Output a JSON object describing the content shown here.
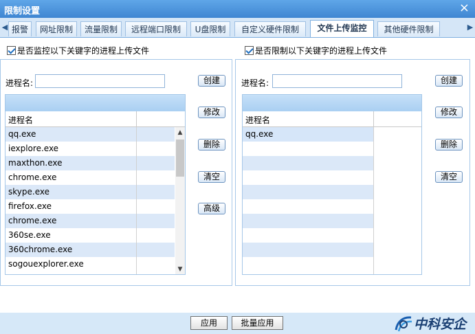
{
  "window": {
    "title": "限制设置",
    "close_symbol": "×"
  },
  "tabs": [
    {
      "label": "报警"
    },
    {
      "label": "网址限制"
    },
    {
      "label": "流量限制"
    },
    {
      "label": "远程端口限制"
    },
    {
      "label": "U盘限制"
    },
    {
      "label": "自定义硬件限制"
    },
    {
      "label": "文件上传监控"
    },
    {
      "label": "其他硬件限制"
    }
  ],
  "active_tab": "文件上传监控",
  "left": {
    "checkbox_label": "是否监控以下关键字的进程上传文件",
    "process_label": "进程名:",
    "process_value": "",
    "column_header": "进程名",
    "rows": [
      "qq.exe",
      "iexplore.exe",
      "maxthon.exe",
      "chrome.exe",
      "skype.exe",
      "firefox.exe",
      "chrome.exe",
      "360se.exe",
      "360chrome.exe",
      "sogouexplorer.exe"
    ],
    "buttons": {
      "create": "创建",
      "modify": "修改",
      "delete": "删除",
      "clear": "清空",
      "advanced": "高级"
    }
  },
  "right": {
    "checkbox_label": "是否限制以下关键字的进程上传文件",
    "process_label": "进程名:",
    "process_value": "",
    "column_header": "进程名",
    "rows": [
      "qq.exe"
    ],
    "buttons": {
      "create": "创建",
      "modify": "修改",
      "delete": "删除",
      "clear": "清空"
    }
  },
  "footer": {
    "apply": "应用",
    "batch_apply": "批量应用",
    "logo_text": "中科安企"
  },
  "colors": {
    "titlebar": "#4a93dc",
    "tab_band": "#d5e6f7",
    "row_alt": "#dbe8f8",
    "bottom_bar": "#d6e8f8"
  }
}
